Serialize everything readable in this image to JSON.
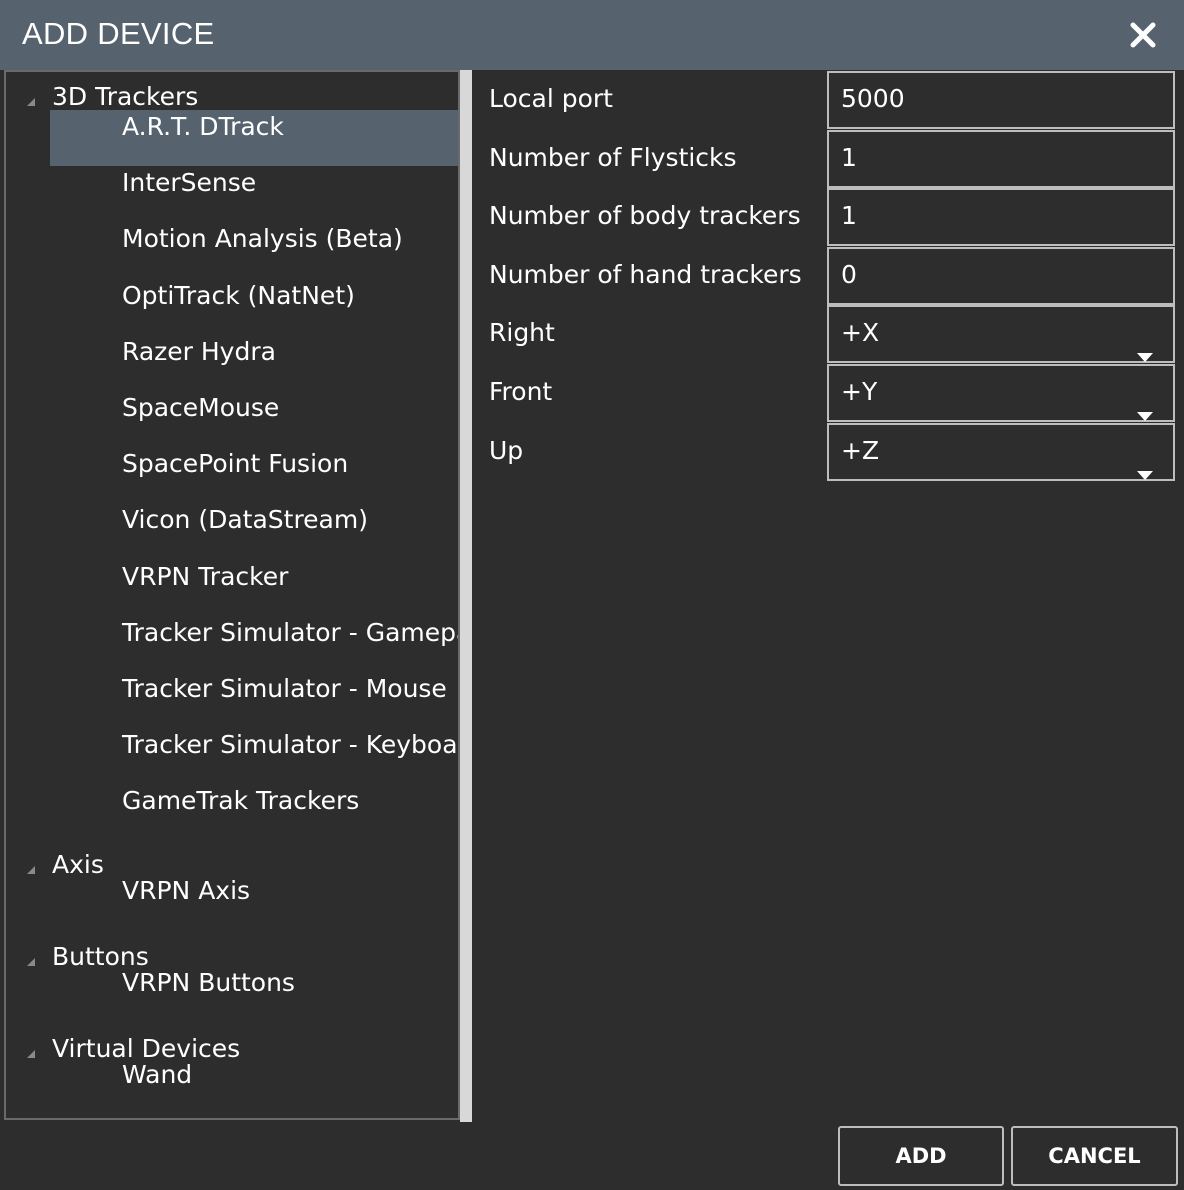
{
  "window": {
    "title": "ADD DEVICE",
    "close_icon": "close-icon"
  },
  "tree": {
    "categories": [
      {
        "label": "3D Trackers",
        "items": [
          "A.R.T. DTrack",
          "InterSense",
          "Motion Analysis (Beta)",
          "OptiTrack (NatNet)",
          "Razer Hydra",
          "SpaceMouse",
          "SpacePoint Fusion",
          "Vicon (DataStream)",
          "VRPN Tracker",
          "Tracker Simulator - Gamepad",
          "Tracker Simulator - Mouse",
          "Tracker Simulator - Keyboard",
          "GameTrak Trackers"
        ]
      },
      {
        "label": "Axis",
        "items": [
          "VRPN Axis"
        ]
      },
      {
        "label": "Buttons",
        "items": [
          "VRPN Buttons"
        ]
      },
      {
        "label": "Virtual Devices",
        "items": [
          "Wand"
        ]
      }
    ],
    "selected": "A.R.T. DTrack"
  },
  "properties": [
    {
      "label": "Local port",
      "value": "5000",
      "kind": "text"
    },
    {
      "label": "Number of Flysticks",
      "value": "1",
      "kind": "text"
    },
    {
      "label": "Number of body trackers",
      "value": "1",
      "kind": "text"
    },
    {
      "label": "Number of hand trackers",
      "value": "0",
      "kind": "text"
    },
    {
      "label": "Right",
      "value": "+X",
      "kind": "select"
    },
    {
      "label": "Front",
      "value": "+Y",
      "kind": "select"
    },
    {
      "label": "Up",
      "value": "+Z",
      "kind": "select"
    }
  ],
  "buttons": {
    "add_label": "ADD",
    "cancel_label": "CANCEL"
  },
  "colors": {
    "titlebar": "#56636f",
    "background": "#2d2d2d",
    "selection": "#56636f",
    "border": "#bdbdbd"
  }
}
